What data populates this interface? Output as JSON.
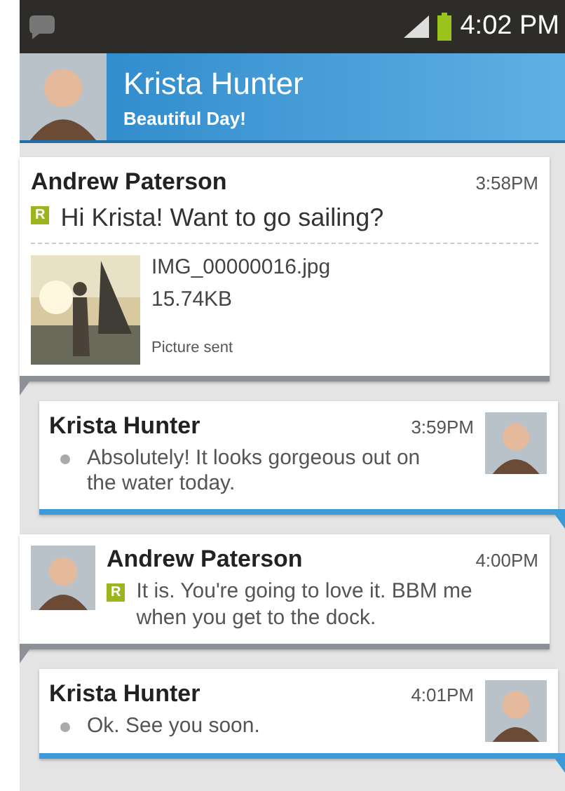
{
  "status_bar": {
    "time": "4:02 PM"
  },
  "header": {
    "name": "Krista Hunter",
    "status": "Beautiful Day!"
  },
  "messages": [
    {
      "kind": "incoming",
      "sender": "Andrew Paterson",
      "time": "3:58PM",
      "avatar": false,
      "receipt": {
        "kind": "read",
        "label": "R"
      },
      "text": "Hi Krista! Want to go sailing?",
      "attachment": {
        "kind": "picture",
        "file": "IMG_00000016.jpg",
        "size": "15.74KB",
        "note": "Picture sent"
      }
    },
    {
      "kind": "outgoing",
      "sender": "Krista Hunter",
      "time": "3:59PM",
      "avatar": true,
      "receipt": {
        "kind": "delivered"
      },
      "text": "Absolutely! It looks gorgeous out on the water today."
    },
    {
      "kind": "incoming",
      "sender": "Andrew Paterson",
      "time": "4:00PM",
      "avatar": true,
      "receipt": {
        "kind": "read",
        "label": "R"
      },
      "text": "It is. You're going to love it. BBM me when you get to the dock."
    },
    {
      "kind": "outgoing",
      "sender": "Krista Hunter",
      "time": "4:01PM",
      "avatar": true,
      "receipt": {
        "kind": "delivered"
      },
      "text": "Ok. See you soon."
    }
  ]
}
